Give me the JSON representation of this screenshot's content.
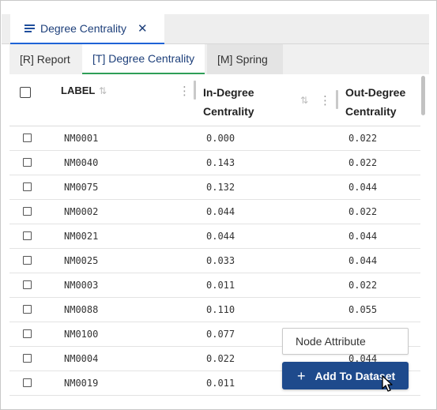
{
  "document_tab": {
    "title": "Degree Centrality",
    "close_glyph": "✕"
  },
  "sub_tabs": [
    {
      "label": "[R] Report"
    },
    {
      "label": "[T] Degree Centrality"
    },
    {
      "label": "[M] Spring"
    }
  ],
  "table": {
    "columns": {
      "label": "LABEL",
      "in_degree": [
        "In-Degree",
        "Centrality"
      ],
      "out_degree": [
        "Out-Degree",
        "Centrality"
      ]
    },
    "rows": [
      {
        "label": "NM0001",
        "in": "0.000",
        "out": "0.022"
      },
      {
        "label": "NM0040",
        "in": "0.143",
        "out": "0.022"
      },
      {
        "label": "NM0075",
        "in": "0.132",
        "out": "0.044"
      },
      {
        "label": "NM0002",
        "in": "0.044",
        "out": "0.022"
      },
      {
        "label": "NM0021",
        "in": "0.044",
        "out": "0.044"
      },
      {
        "label": "NM0025",
        "in": "0.033",
        "out": "0.044"
      },
      {
        "label": "NM0003",
        "in": "0.011",
        "out": "0.022"
      },
      {
        "label": "NM0088",
        "in": "0.110",
        "out": "0.055"
      },
      {
        "label": "NM0100",
        "in": "0.077",
        "out": ""
      },
      {
        "label": "NM0004",
        "in": "0.022",
        "out": "0.044"
      },
      {
        "label": "NM0019",
        "in": "0.011",
        "out": ""
      }
    ]
  },
  "popup": {
    "node_attribute": "Node Attribute",
    "add_to_dataset": "Add To Dataset"
  },
  "colors": {
    "accent": "#1e63d6",
    "active_subtab_underline": "#2e9e57",
    "button": "#1e4a8c"
  },
  "icons": {
    "tab_menu": "menu-lines-icon",
    "sort": "sort-arrows-icon",
    "column_menu": "kebab-icon",
    "add": "plus-icon",
    "pointer": "mouse-cursor-icon"
  }
}
